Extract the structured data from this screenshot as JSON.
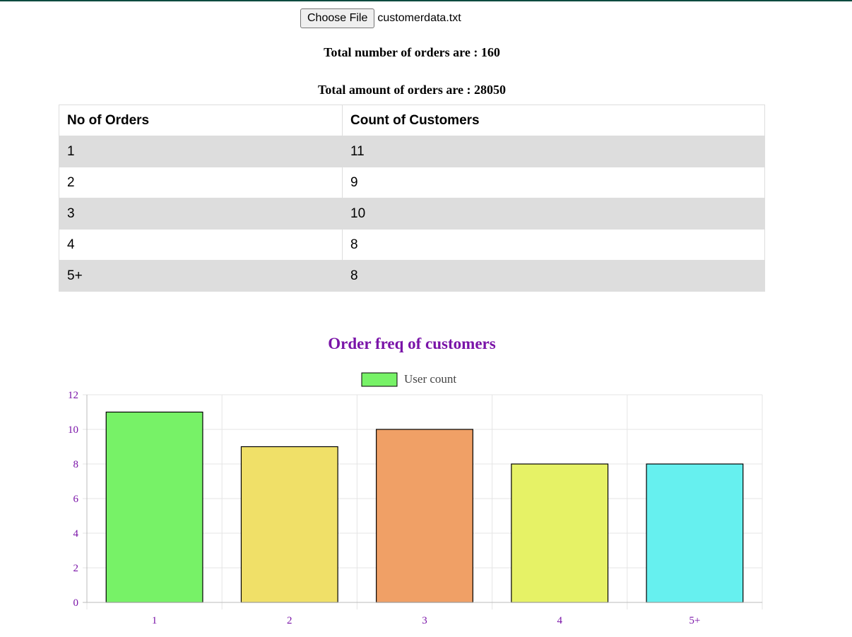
{
  "file_input": {
    "button_label": "Choose File",
    "file_name": "customerdata.txt"
  },
  "summary": {
    "total_orders_text": "Total number of orders are : 160",
    "total_amount_text": "Total amount of orders are : 28050"
  },
  "table": {
    "headers": [
      "No of Orders",
      "Count of Customers"
    ],
    "rows": [
      [
        "1",
        "11"
      ],
      [
        "2",
        "9"
      ],
      [
        "3",
        "10"
      ],
      [
        "4",
        "8"
      ],
      [
        "5+",
        "8"
      ]
    ]
  },
  "colors": {
    "accent": "#7a14a8",
    "top_rule": "#0d4b3f",
    "row_shade": "#dddddd",
    "grid": "#e5e5e5",
    "bar_border": "#000000"
  },
  "chart_data": {
    "type": "bar",
    "title": "Order freq of customers",
    "categories": [
      "1",
      "2",
      "3",
      "4",
      "5+"
    ],
    "series": [
      {
        "name": "User count",
        "values": [
          11,
          9,
          10,
          8,
          8
        ],
        "colors": [
          "#77f267",
          "#f0e068",
          "#f0a066",
          "#e6f266",
          "#66f0ef"
        ],
        "legend_color": "#77f267"
      }
    ],
    "ylim": [
      0,
      12
    ],
    "yticks": [
      0,
      2,
      4,
      6,
      8,
      10,
      12
    ],
    "xlabel": "",
    "ylabel": "",
    "grid": true,
    "legend_position": "top-center"
  }
}
